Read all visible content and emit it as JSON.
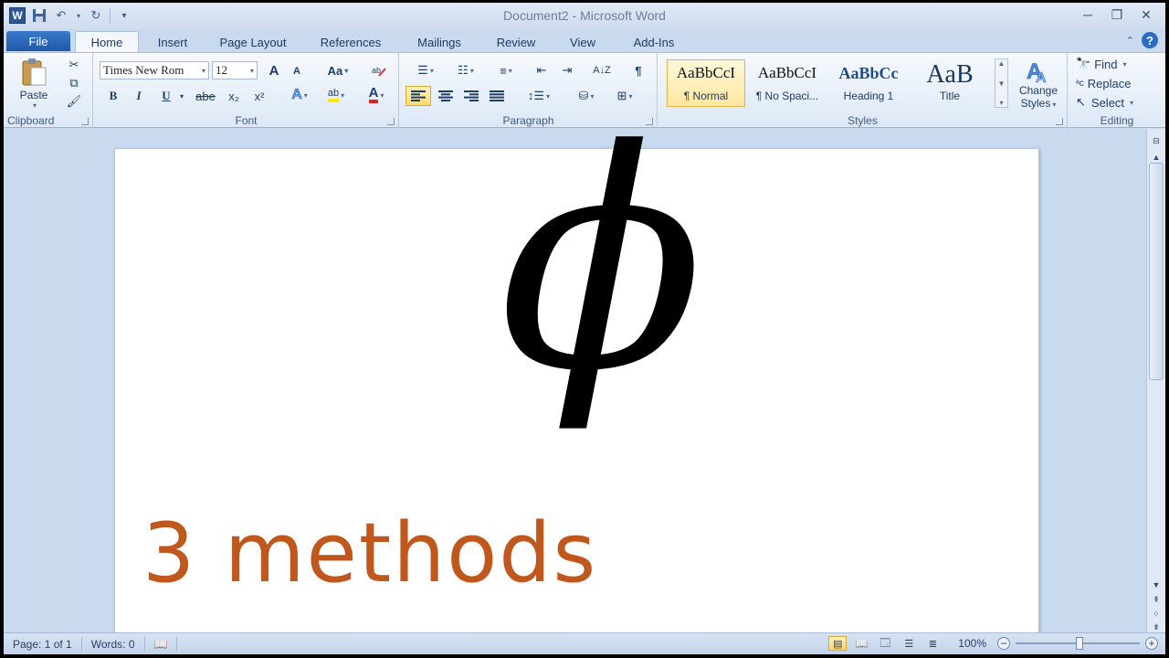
{
  "window": {
    "title": "Document2 - Microsoft Word",
    "app_icon": "W",
    "minimize_icon": "─",
    "restore_icon": "❐",
    "close_icon": "✕"
  },
  "quick_access": {
    "save_icon": "save-icon",
    "undo_icon": "undo-icon",
    "redo_icon": "redo-icon",
    "customize_icon": "customize-icon"
  },
  "tabs": {
    "file": "File",
    "home": "Home",
    "insert": "Insert",
    "page_layout": "Page Layout",
    "references": "References",
    "mailings": "Mailings",
    "review": "Review",
    "view": "View",
    "addins": "Add-Ins",
    "help": "?"
  },
  "ribbon": {
    "clipboard": {
      "label": "Clipboard",
      "paste": "Paste"
    },
    "font": {
      "label": "Font",
      "font_name": "Times New Rom",
      "font_size": "12",
      "grow": "A",
      "shrink": "A",
      "change_case": "Aa",
      "bold": "B",
      "italic": "I",
      "underline": "U",
      "strike": "abe",
      "subscript": "x₂",
      "superscript": "x²",
      "text_effects": "A",
      "highlight": "ab",
      "font_color": "A"
    },
    "paragraph": {
      "label": "Paragraph",
      "show_marks": "¶"
    },
    "styles": {
      "label": "Styles",
      "items": [
        {
          "sample": "AaBbCcI",
          "name": "¶ Normal"
        },
        {
          "sample": "AaBbCcI",
          "name": "¶ No Spaci..."
        },
        {
          "sample": "AaBbCc",
          "name": "Heading 1"
        },
        {
          "sample": "AaB",
          "name": "Title"
        }
      ],
      "change_styles_1": "Change",
      "change_styles_2": "Styles"
    },
    "editing": {
      "label": "Editing",
      "find": "Find",
      "replace": "Replace",
      "select": "Select"
    }
  },
  "document": {
    "symbol": "ϕ",
    "text": "3 methods"
  },
  "status": {
    "page": "Page: 1 of 1",
    "words": "Words: 0",
    "zoom": "100%"
  },
  "colors": {
    "accent": "#2b5797",
    "methods_text": "#c0571d",
    "selected_style": "#ffe79e"
  }
}
